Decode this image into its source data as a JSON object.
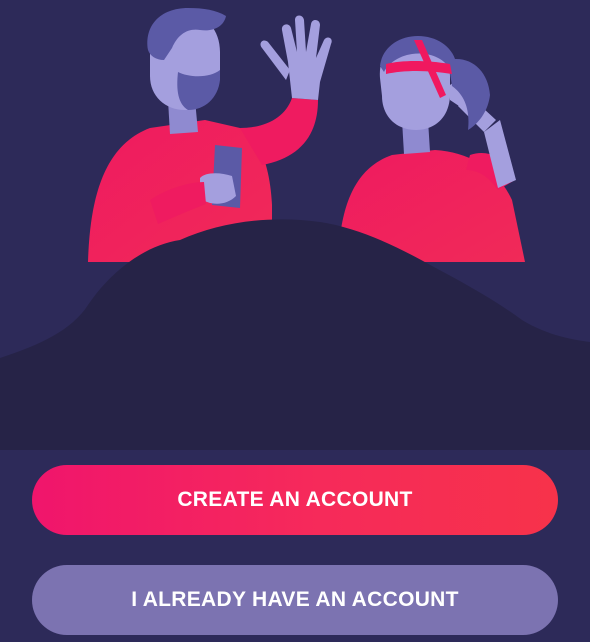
{
  "buttons": {
    "create_account_label": "CREATE AN ACCOUNT",
    "have_account_label": "I ALREADY HAVE AN ACCOUNT"
  },
  "colors": {
    "background": "#2d2a59",
    "hill": "#262347",
    "primary_button_start": "#f0156c",
    "primary_button_end": "#f7324a",
    "secondary_button": "#7c73b1",
    "character_shirt": "#f0175f",
    "character_skin": "#a49fde"
  },
  "icons": {
    "illustration": "people-waving-illustration"
  }
}
